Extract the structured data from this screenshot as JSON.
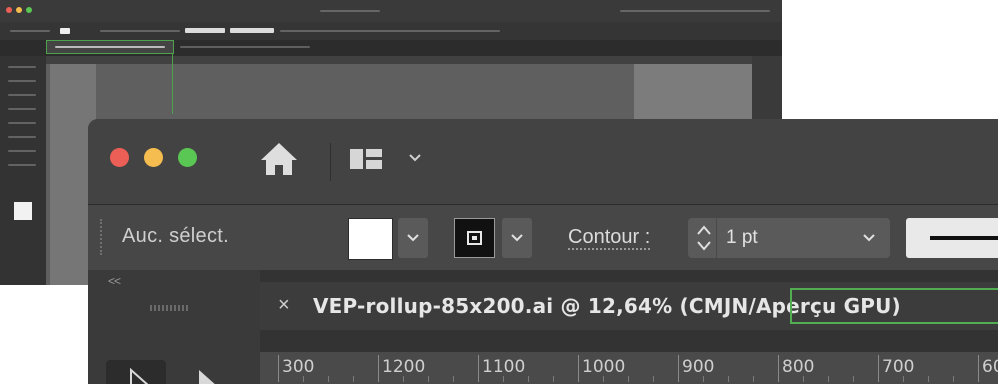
{
  "colors": {
    "close": "#ec5f56",
    "minimize": "#f5bd4f",
    "zoom": "#5ac754",
    "highlight": "#52ad52"
  },
  "toolbar": {
    "home_icon": "home-icon",
    "workspace_icon": "workspace-layout-icon"
  },
  "options": {
    "selection_label": "Auc. sélect.",
    "contour_label": "Contour :",
    "stroke_weight": "1 pt"
  },
  "document": {
    "tab_title": "VEP-rollup-85x200.ai @ 12,64% ",
    "mode": "(CMJN/Aperçu GPU)",
    "close_glyph": "×"
  },
  "panel": {
    "collapse_glyph": "<<"
  },
  "ruler": {
    "labels": [
      "300",
      "1200",
      "1100",
      "1000",
      "900",
      "800",
      "700",
      "60"
    ]
  }
}
